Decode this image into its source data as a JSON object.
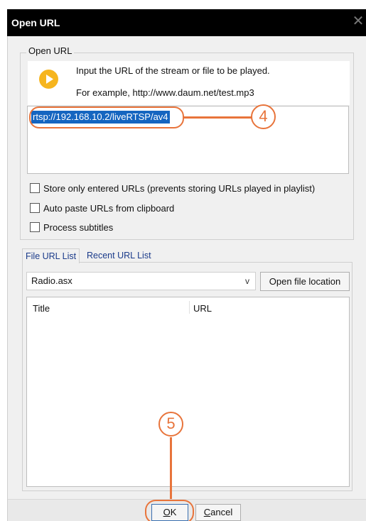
{
  "window": {
    "title": "Open URL",
    "close_glyph": "✕"
  },
  "group": {
    "legend": "Open URL",
    "info_line1": "Input the URL of the stream or file to be played.",
    "info_line2": "For example, http://www.daum.net/test.mp3",
    "play_icon": "play-icon",
    "play_icon_color": "#f6b51e"
  },
  "url_field": {
    "value": "rtsp://192.168.10.2/liveRTSP/av4",
    "selection_color": "#1565c0"
  },
  "options": [
    {
      "label": "Store only entered URLs (prevents storing URLs played in playlist)",
      "checked": false
    },
    {
      "label": "Auto paste URLs from clipboard",
      "checked": false
    },
    {
      "label": "Process subtitles",
      "checked": false
    }
  ],
  "tabs": {
    "file_url_list": "File URL List",
    "recent_url_list": "Recent URL List"
  },
  "file_select": {
    "value": "Radio.asx",
    "chevron": "v"
  },
  "open_file_location": "Open file location",
  "list": {
    "columns": [
      "Title",
      "URL"
    ]
  },
  "buttons": {
    "ok_mnemonic": "O",
    "ok_rest": "K",
    "cancel_mnemonic": "C",
    "cancel_rest": "ancel"
  },
  "callouts": {
    "four": "4",
    "five": "5",
    "color": "#e8743b"
  }
}
